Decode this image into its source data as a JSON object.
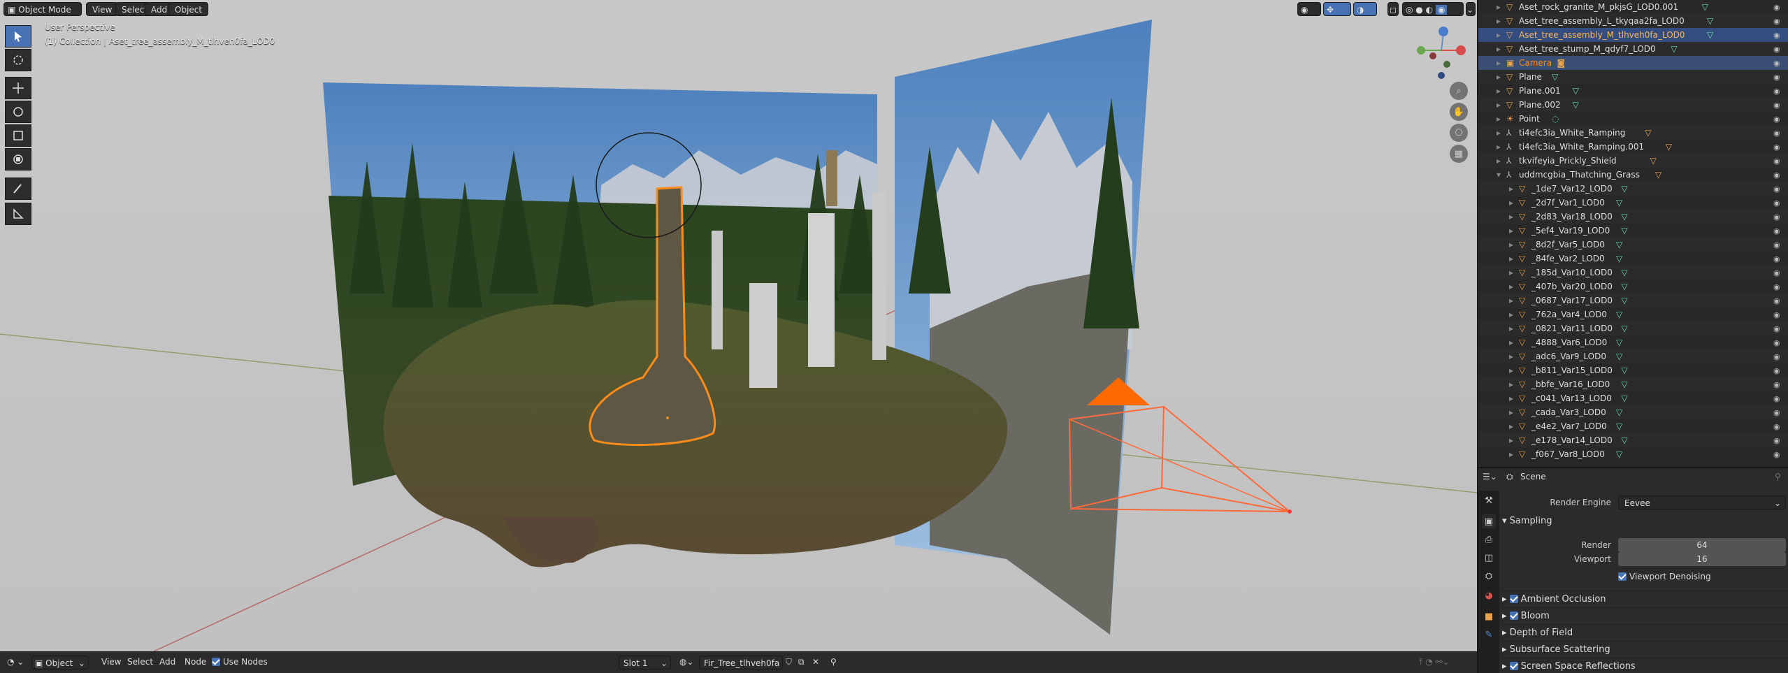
{
  "header": {
    "mode": "Object Mode",
    "menu": [
      "View",
      "Select",
      "Add",
      "Object"
    ]
  },
  "viewport": {
    "perspective": "User Perspective",
    "collection_info": "(1) Collection | Aset_tree_assembly_M_tlhveh0fa_LOD0"
  },
  "outliner": {
    "rows": [
      {
        "name": "Aset_rock_granite_M_pkjsG_LOD0.001",
        "type": "mesh",
        "indent": 1
      },
      {
        "name": "Aset_tree_assembly_L_tkyqaa2fa_LOD0",
        "type": "mesh",
        "indent": 1
      },
      {
        "name": "Aset_tree_assembly_M_tlhveh0fa_LOD0",
        "type": "mesh",
        "indent": 1,
        "selected": true
      },
      {
        "name": "Aset_tree_stump_M_qdyf7_LOD0",
        "type": "mesh",
        "indent": 1
      },
      {
        "name": "Camera",
        "type": "camera",
        "indent": 1,
        "active": true
      },
      {
        "name": "Plane",
        "type": "mesh",
        "indent": 1
      },
      {
        "name": "Plane.001",
        "type": "mesh",
        "indent": 1
      },
      {
        "name": "Plane.002",
        "type": "mesh",
        "indent": 1
      },
      {
        "name": "Point",
        "type": "light",
        "indent": 1
      },
      {
        "name": "ti4efc3ia_White_Ramping",
        "type": "armature",
        "indent": 1
      },
      {
        "name": "ti4efc3ia_White_Ramping.001",
        "type": "armature",
        "indent": 1
      },
      {
        "name": "tkvifeyia_Prickly_Shield",
        "type": "armature",
        "indent": 1
      },
      {
        "name": "uddmcgbia_Thatching_Grass",
        "type": "armature",
        "indent": 1,
        "expanded": true
      },
      {
        "name": "_1de7_Var12_LOD0",
        "type": "mesh",
        "indent": 2
      },
      {
        "name": "_2d7f_Var1_LOD0",
        "type": "mesh",
        "indent": 2
      },
      {
        "name": "_2d83_Var18_LOD0",
        "type": "mesh",
        "indent": 2
      },
      {
        "name": "_5ef4_Var19_LOD0",
        "type": "mesh",
        "indent": 2
      },
      {
        "name": "_8d2f_Var5_LOD0",
        "type": "mesh",
        "indent": 2
      },
      {
        "name": "_84fe_Var2_LOD0",
        "type": "mesh",
        "indent": 2
      },
      {
        "name": "_185d_Var10_LOD0",
        "type": "mesh",
        "indent": 2
      },
      {
        "name": "_407b_Var20_LOD0",
        "type": "mesh",
        "indent": 2
      },
      {
        "name": "_0687_Var17_LOD0",
        "type": "mesh",
        "indent": 2
      },
      {
        "name": "_762a_Var4_LOD0",
        "type": "mesh",
        "indent": 2
      },
      {
        "name": "_0821_Var11_LOD0",
        "type": "mesh",
        "indent": 2
      },
      {
        "name": "_4888_Var6_LOD0",
        "type": "mesh",
        "indent": 2
      },
      {
        "name": "_adc6_Var9_LOD0",
        "type": "mesh",
        "indent": 2
      },
      {
        "name": "_b811_Var15_LOD0",
        "type": "mesh",
        "indent": 2
      },
      {
        "name": "_bbfe_Var16_LOD0",
        "type": "mesh",
        "indent": 2
      },
      {
        "name": "_c041_Var13_LOD0",
        "type": "mesh",
        "indent": 2
      },
      {
        "name": "_cada_Var3_LOD0",
        "type": "mesh",
        "indent": 2
      },
      {
        "name": "_e4e2_Var7_LOD0",
        "type": "mesh",
        "indent": 2
      },
      {
        "name": "_e178_Var14_LOD0",
        "type": "mesh",
        "indent": 2
      },
      {
        "name": "_f067_Var8_LOD0",
        "type": "mesh",
        "indent": 2
      }
    ]
  },
  "properties": {
    "context": "Scene",
    "render_engine_label": "Render Engine",
    "render_engine_value": "Eevee",
    "sampling_label": "Sampling",
    "render_label": "Render",
    "render_value": "64",
    "viewport_label": "Viewport",
    "viewport_value": "16",
    "denoise_label": "Viewport Denoising",
    "panels": [
      {
        "label": "Ambient Occlusion",
        "checkbox": true
      },
      {
        "label": "Bloom",
        "checkbox": true
      },
      {
        "label": "Depth of Field",
        "checkbox": false
      },
      {
        "label": "Subsurface Scattering",
        "checkbox": false
      },
      {
        "label": "Screen Space Reflections",
        "checkbox": true
      }
    ]
  },
  "bottombar": {
    "mode": "Object",
    "menu": [
      "View",
      "Select",
      "Add",
      "Node"
    ],
    "use_nodes": "Use Nodes",
    "slot": "Slot 1",
    "material": "Fir_Tree_tlhveh0fa"
  },
  "colors": {
    "accent": "#4772b3",
    "selected_orange": "#ff8c1a",
    "mesh_green": "#66d9a6",
    "object_orange": "#e9a14c"
  }
}
